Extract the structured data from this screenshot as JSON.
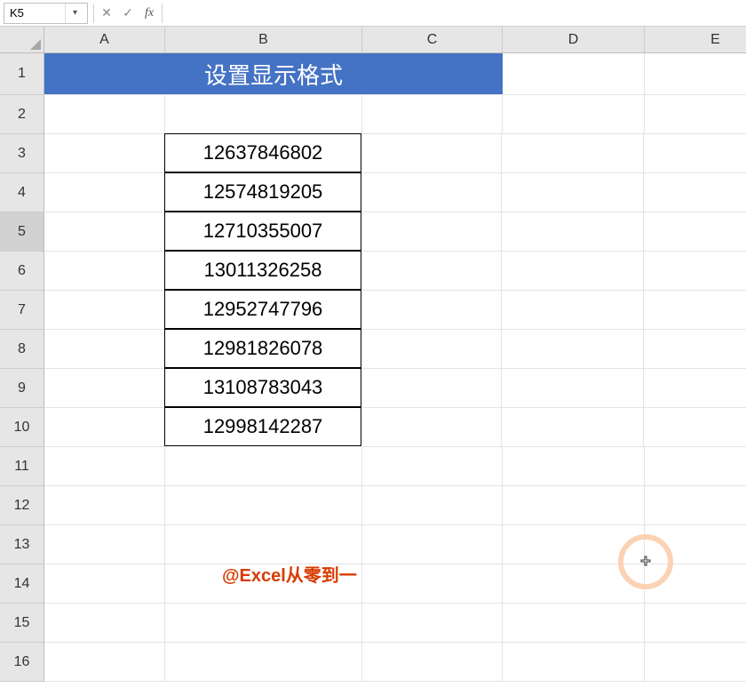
{
  "nameBox": {
    "value": "K5"
  },
  "formulaBar": {
    "value": ""
  },
  "columns": [
    {
      "letter": "A",
      "cls": "cA"
    },
    {
      "letter": "B",
      "cls": "cB"
    },
    {
      "letter": "C",
      "cls": "cC"
    },
    {
      "letter": "D",
      "cls": "cD"
    },
    {
      "letter": "E",
      "cls": "cE"
    }
  ],
  "rows": [
    1,
    2,
    3,
    4,
    5,
    6,
    7,
    8,
    9,
    10,
    11,
    12,
    13,
    14,
    15,
    16
  ],
  "activeRow": 5,
  "title": "设置显示格式",
  "dataColumn": {
    "startRow": 3,
    "values": [
      "12637846802",
      "12574819205",
      "12710355007",
      "13011326258",
      "12952747796",
      "12981826078",
      "13108783043",
      "12998142287"
    ]
  },
  "watermark": {
    "text": "@Excel从零到一"
  },
  "icons": {
    "cancel": "✕",
    "confirm": "✓",
    "fx": "fx",
    "dropdown": "▾"
  }
}
